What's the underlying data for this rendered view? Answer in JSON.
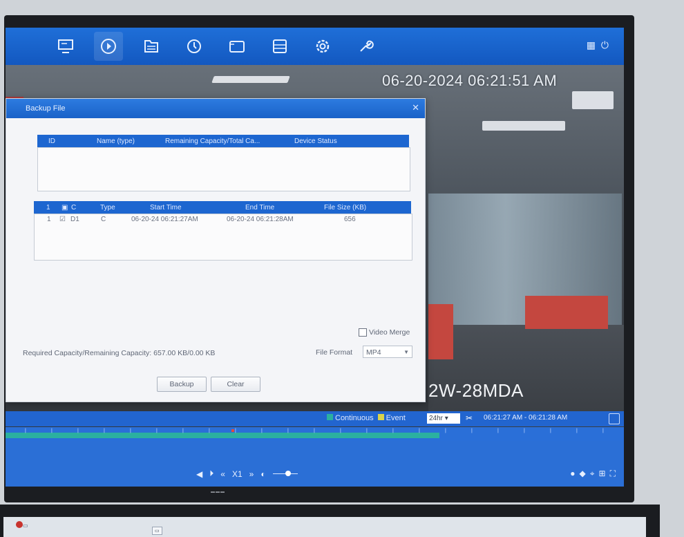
{
  "toolbar": {
    "icons": [
      "live-view-icon",
      "playback-icon",
      "file-manage-icon",
      "smart-icon",
      "camera-icon",
      "storage-icon",
      "settings-icon",
      "maintenance-icon"
    ]
  },
  "clock": "06-20-2024 06:21:51 AM",
  "camera_name": "2W-28MDA",
  "dialog": {
    "title": "Backup File",
    "device_table": {
      "headers": [
        "ID",
        "Name (type)",
        "Remaining Capacity/Total Ca...",
        "Device Status"
      ]
    },
    "file_table": {
      "headers": [
        "",
        "",
        "C",
        "Type",
        "Start Time",
        "End Time",
        "File Size (KB)"
      ],
      "rows": [
        {
          "index": "1",
          "channel": "D1",
          "type": "C",
          "start": "06-20-24 06:21:27AM",
          "end": "06-20-24 06:21:28AM",
          "size": "656"
        }
      ]
    },
    "video_merge_label": "Video Merge",
    "required_label": "Required Capacity/Remaining Capacity:",
    "required_value": "657.00 KB/0.00 KB",
    "file_format_label": "File Format",
    "file_format_value": "MP4",
    "backup_label": "Backup",
    "clear_label": "Clear"
  },
  "timeline": {
    "legend_continuous": "Continuous",
    "legend_event": "Event",
    "range_select": "24hr",
    "range_text": "06:21:27 AM - 06:21:28 AM",
    "colors": {
      "continuous": "#2bb0a0",
      "event": "#d9d24a"
    }
  },
  "playback": {
    "speed": "X1"
  }
}
